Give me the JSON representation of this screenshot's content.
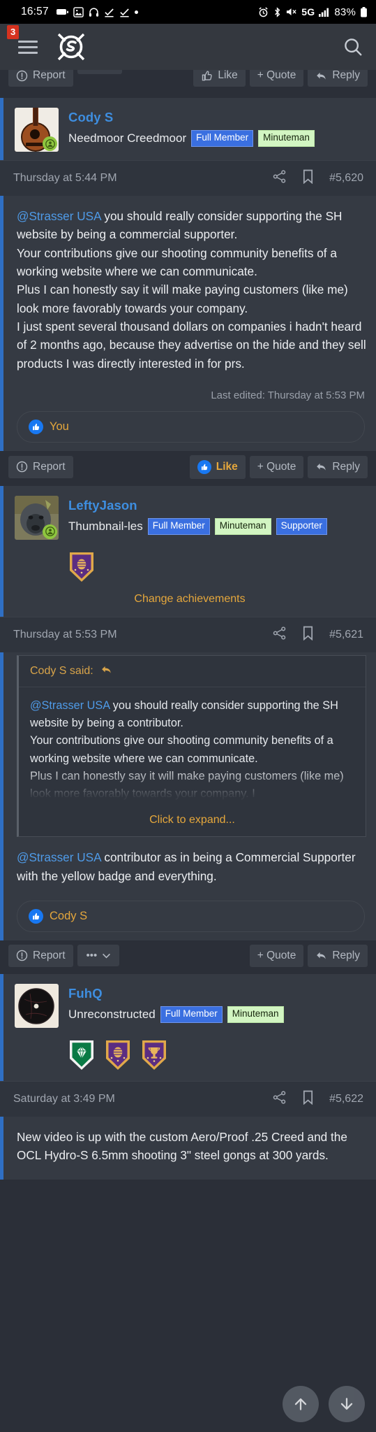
{
  "status_bar": {
    "time": "16:57",
    "network": "5G",
    "battery_pct": "83%",
    "icons": [
      "battery-saver-icon",
      "photo-icon",
      "headphones-icon",
      "download-complete-icon",
      "download-complete-icon",
      "dot-icon",
      "alarm-icon",
      "bluetooth-icon",
      "mute-icon",
      "signal-bars-icon",
      "battery-icon"
    ]
  },
  "navbar": {
    "menu_badge": "3",
    "menu_icon": "hamburger-menu-icon",
    "logo_icon": "sniper-hide-logo-icon",
    "search_icon": "search-icon"
  },
  "top_action_row": {
    "report_label": "Report",
    "like_label": "Like",
    "quote_label": "+ Quote",
    "reply_label": "Reply"
  },
  "posts": [
    {
      "id": "post-5620",
      "username": "Cody S",
      "user_title": "Needmoor Creedmoor",
      "avatar_icon": "guitar-avatar",
      "online": true,
      "badges": [
        {
          "label": "Full Member",
          "style": "blue"
        },
        {
          "label": "Minuteman",
          "style": "green"
        }
      ],
      "trophies": [],
      "change_achievements": null,
      "timestamp": "Thursday at 5:44 PM",
      "post_number": "#5,620",
      "share_icon": "share-icon",
      "bookmark_icon": "bookmark-icon",
      "body_mention": "@Strasser USA",
      "body_text": " you should really consider supporting the SH website by being a commercial supporter.\nYour contributions give our shooting community benefits of a working website where we can communicate.\nPlus I can honestly say it will make paying customers (like me) look more favorably towards your company.\nI just spent several thousand dollars on companies i hadn't heard of 2 months ago, because they advertise on the hide and they sell products I was directly interested in for prs.",
      "last_edited": "Last edited: Thursday at 5:53 PM",
      "reaction_name": "You",
      "reaction_icon": "thumbs-up-icon",
      "actions": {
        "report_label": "Report",
        "like_label": "Like",
        "like_active": true,
        "quote_label": "+ Quote",
        "reply_label": "Reply"
      }
    },
    {
      "id": "post-5621",
      "username": "LeftyJason",
      "user_title": "Thumbnail-les",
      "avatar_icon": "gorilla-avatar",
      "online": true,
      "badges": [
        {
          "label": "Full Member",
          "style": "blue"
        },
        {
          "label": "Minuteman",
          "style": "green"
        },
        {
          "label": "Supporter",
          "style": "blue"
        }
      ],
      "trophies": [
        "purple-beehive-shield-trophy"
      ],
      "change_achievements": "Change achievements",
      "timestamp": "Thursday at 5:53 PM",
      "post_number": "#5,621",
      "share_icon": "share-icon",
      "bookmark_icon": "bookmark-icon",
      "quote": {
        "attribution": "Cody S said:",
        "reply_arrow_icon": "quote-jump-icon",
        "mention": "@Strasser USA",
        "text": " you should really consider supporting the SH website by being a contributor.\nYour contributions give our shooting community benefits of a working website where we can communicate.\nPlus I can honestly say it will make paying customers (like me) look more favorably towards your company. I",
        "expand_label": "Click to expand..."
      },
      "body_mention": "@Strasser USA",
      "body_text": " contributor as in being a Commercial Supporter with the yellow badge and everything.",
      "reaction_name": "Cody S",
      "reaction_icon": "thumbs-up-icon",
      "actions": {
        "report_label": "Report",
        "more_label": "•••",
        "more_icon": "chevron-down-icon",
        "quote_label": "+ Quote",
        "reply_label": "Reply"
      }
    },
    {
      "id": "post-5622",
      "username": "FuhQ",
      "user_title": "Unreconstructed",
      "avatar_icon": "target-plate-avatar",
      "online": false,
      "badges": [
        {
          "label": "Full Member",
          "style": "blue"
        },
        {
          "label": "Minuteman",
          "style": "green"
        }
      ],
      "trophies": [
        "green-diamond-shield-trophy",
        "purple-beehive-shield-trophy",
        "purple-trophy-shield-trophy"
      ],
      "change_achievements": null,
      "timestamp": "Saturday at 3:49 PM",
      "post_number": "#5,622",
      "share_icon": "share-icon",
      "bookmark_icon": "bookmark-icon",
      "body_text": "New video is up with the custom Aero/Proof .25 Creed and the OCL Hydro-S 6.5mm shooting 3\" steel gongs at 300 yards."
    }
  ],
  "fabs": {
    "scroll_up_icon": "arrow-up-icon",
    "scroll_down_icon": "arrow-down-icon"
  },
  "colors": {
    "accent_blue": "#3e8ee0",
    "accent_orange": "#e5a73c",
    "badge_blue": "#3a6fe0",
    "badge_green": "#d2f5c2",
    "post_bg": "#353a43",
    "page_bg": "#2b2f38"
  }
}
